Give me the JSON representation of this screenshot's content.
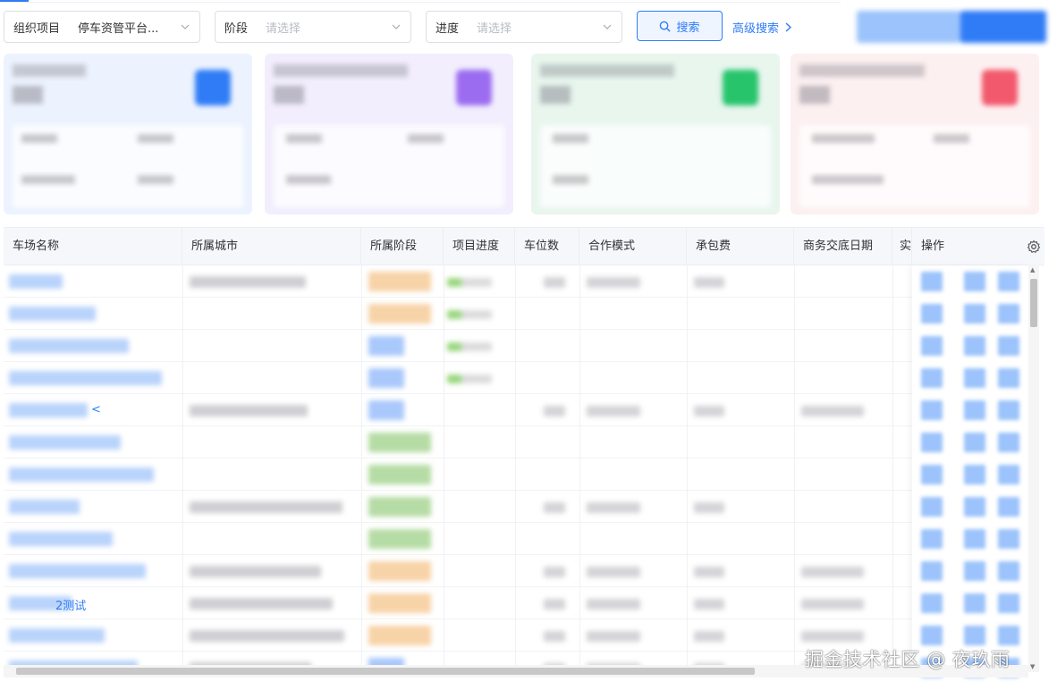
{
  "filters": {
    "org": {
      "label": "组织项目",
      "value": "停车资管平台..."
    },
    "stage": {
      "label": "阶段",
      "placeholder": "请选择"
    },
    "progress": {
      "label": "进度",
      "placeholder": "请选择"
    }
  },
  "actions": {
    "search_label": "搜索",
    "advanced_label": "高级搜索"
  },
  "table": {
    "columns": [
      "车场名称",
      "所属城市",
      "所属阶段",
      "项目进度",
      "车位数",
      "合作模式",
      "承包费",
      "商务交底日期",
      "实",
      "操作"
    ],
    "visible_row_text": {
      "row5_suffix": "<",
      "row11_suffix": "2测试"
    }
  },
  "watermark": "掘金技术社区 @ 夜玖雨",
  "colors": {
    "primary": "#2f7cf6",
    "card_blue": "#edf3fe",
    "card_purple": "#f2eefd",
    "card_green": "#e8f6ee",
    "card_red": "#fdf0f1",
    "stage_orange": "#f7d3a8",
    "stage_blue": "#a9c8fb",
    "stage_green": "#b6dca5"
  },
  "icons": [
    "search-icon",
    "chevron-down-icon",
    "chevron-right-icon",
    "gear-icon"
  ]
}
